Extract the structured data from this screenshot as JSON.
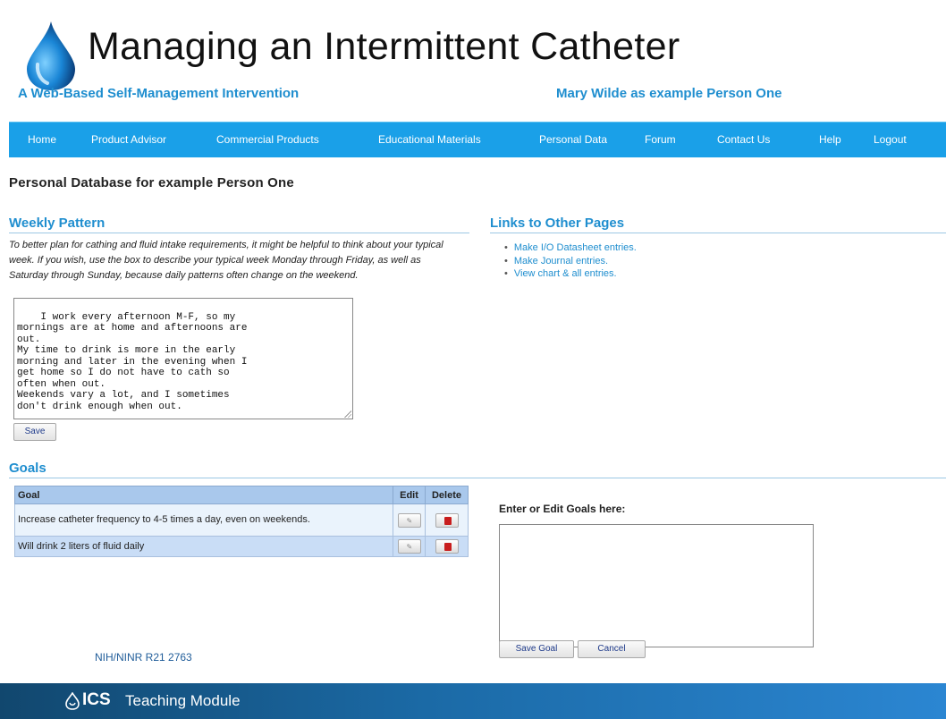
{
  "header": {
    "title": "Managing an Intermittent Catheter",
    "subtitle": "A Web-Based Self-Management Intervention",
    "user_label": "Mary Wilde as example Person One"
  },
  "nav": {
    "items": [
      {
        "label": "Home"
      },
      {
        "label": "Product Advisor"
      },
      {
        "label": "Commercial Products"
      },
      {
        "label": "Educational Materials"
      },
      {
        "label": "Personal Data"
      },
      {
        "label": "Forum"
      },
      {
        "label": "Contact Us"
      },
      {
        "label": "Help"
      },
      {
        "label": "Logout"
      }
    ]
  },
  "page": {
    "heading": "Personal Database for example Person One"
  },
  "weekly_pattern": {
    "heading": "Weekly Pattern",
    "instructions": "To better plan for cathing and fluid intake requirements, it might be helpful to think about your typical week. If you wish, use the box to describe your typical week Monday through Friday, as well as Saturday through Sunday, because daily patterns often change on the weekend.",
    "text": "I work every afternoon M-F, so my\nmornings are at home and afternoons are\nout.\nMy time to drink is more in the early\nmorning and later in the evening when I\nget home so I do not have to cath so\noften when out.\nWeekends vary a lot, and I sometimes\ndon't drink enough when out.",
    "save_label": "Save"
  },
  "links": {
    "heading": "Links to Other Pages",
    "items": [
      {
        "label": "Make I/O Datasheet entries."
      },
      {
        "label": "Make Journal entries."
      },
      {
        "label": "View chart & all entries."
      }
    ]
  },
  "goals": {
    "heading": "Goals",
    "columns": {
      "goal": "Goal",
      "edit": "Edit",
      "delete": "Delete"
    },
    "rows": [
      {
        "goal": "Increase catheter frequency to 4-5 times a day, even on weekends."
      },
      {
        "goal": "Will drink 2 liters of fluid daily"
      }
    ],
    "entry_label": "Enter or Edit Goals here:",
    "entry_value": "",
    "save_label": "Save Goal",
    "cancel_label": "Cancel"
  },
  "grant": "NIH/NINR R21 2763",
  "footer": {
    "brand": "ICS",
    "module": "Teaching Module"
  },
  "colors": {
    "nav_bar": "#1aa0e8",
    "accent_text": "#1f8ecf",
    "table_header": "#a9c8ec",
    "footer_dark": "#11476e",
    "footer_light": "#2b86d2"
  },
  "icons": {
    "logo": "water-drop-icon",
    "edit": "pencil-icon",
    "delete": "trash-icon",
    "footer_logo": "ics-logo-icon"
  }
}
